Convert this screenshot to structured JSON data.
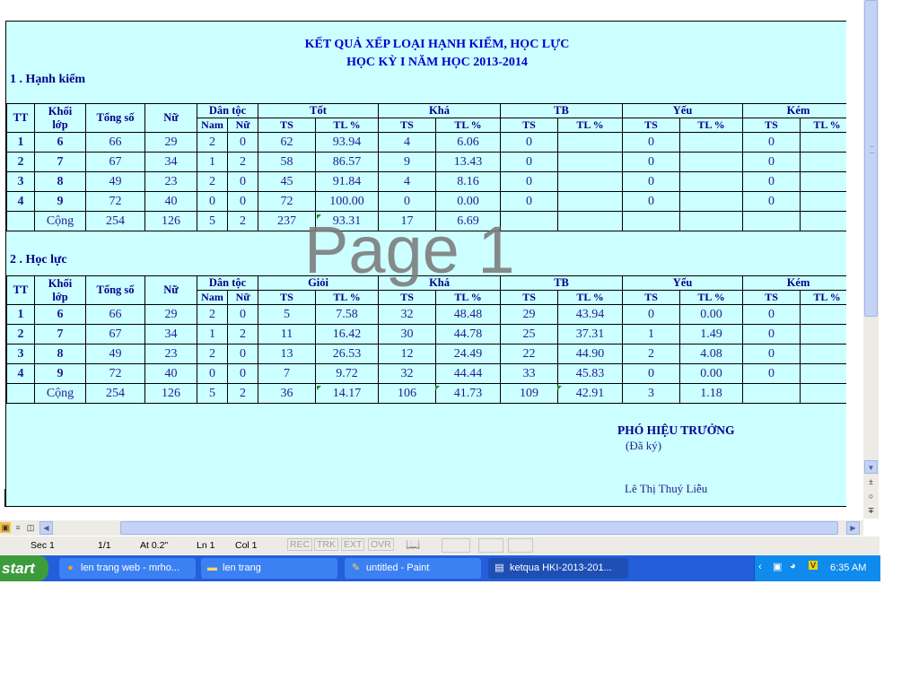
{
  "document": {
    "title_line1": "KẾT QUẢ XẾP LOẠI HẠNH KIỂM, HỌC LỰC",
    "title_line2": "HỌC KỲ I NĂM HỌC 2013-2014",
    "section1_label": "1 .  Hạnh kiểm",
    "section2_label": "2 .  Học lực",
    "watermark": "Page 1",
    "common_headers": {
      "tt": "TT",
      "khoi_line1": "Khối",
      "khoi_line2": "lớp",
      "tong_so": "Tổng số",
      "nu": "Nữ",
      "dan_toc": "Dân tộc",
      "nam": "Nam",
      "nu_sub": "Nữ",
      "ts": "TS",
      "tl": "TL %"
    },
    "conduct_table": {
      "groups": [
        "Tốt",
        "Khá",
        "TB",
        "Yếu",
        "Kém"
      ],
      "rows": [
        [
          "1",
          "6",
          "66",
          "29",
          "2",
          "0",
          "62",
          "93.94",
          "4",
          "6.06",
          "0",
          "",
          "0",
          "",
          "0",
          ""
        ],
        [
          "2",
          "7",
          "67",
          "34",
          "1",
          "2",
          "58",
          "86.57",
          "9",
          "13.43",
          "0",
          "",
          "0",
          "",
          "0",
          ""
        ],
        [
          "3",
          "8",
          "49",
          "23",
          "2",
          "0",
          "45",
          "91.84",
          "4",
          "8.16",
          "0",
          "",
          "0",
          "",
          "0",
          ""
        ],
        [
          "4",
          "9",
          "72",
          "40",
          "0",
          "0",
          "72",
          "100.00",
          "0",
          "0.00",
          "0",
          "",
          "0",
          "",
          "0",
          ""
        ],
        [
          "",
          "Cộng",
          "254",
          "126",
          "5",
          "2",
          "237",
          "93.31",
          "17",
          "6.69",
          "",
          "",
          "",
          "",
          "",
          ""
        ]
      ]
    },
    "academic_table": {
      "groups": [
        "Giỏi",
        "Khá",
        "TB",
        "Yếu",
        "Kém"
      ],
      "rows": [
        [
          "1",
          "6",
          "66",
          "29",
          "2",
          "0",
          "5",
          "7.58",
          "32",
          "48.48",
          "29",
          "43.94",
          "0",
          "0.00",
          "0",
          ""
        ],
        [
          "2",
          "7",
          "67",
          "34",
          "1",
          "2",
          "11",
          "16.42",
          "30",
          "44.78",
          "25",
          "37.31",
          "1",
          "1.49",
          "0",
          ""
        ],
        [
          "3",
          "8",
          "49",
          "23",
          "2",
          "0",
          "13",
          "26.53",
          "12",
          "24.49",
          "22",
          "44.90",
          "2",
          "4.08",
          "0",
          ""
        ],
        [
          "4",
          "9",
          "72",
          "40",
          "0",
          "0",
          "7",
          "9.72",
          "32",
          "44.44",
          "33",
          "45.83",
          "0",
          "0.00",
          "0",
          ""
        ],
        [
          "",
          "Cộng",
          "254",
          "126",
          "5",
          "2",
          "36",
          "14.17",
          "106",
          "41.73",
          "109",
          "42.91",
          "3",
          "1.18",
          "",
          ""
        ]
      ]
    },
    "signature": {
      "title": "PHÓ HIỆU TRƯỞNG",
      "note": "(Đã ký)",
      "name": "Lê Thị Thuý Liễu"
    }
  },
  "status_bar": {
    "section": "Sec 1",
    "page": "1/1",
    "at": "At 0.2\"",
    "line": "Ln 1",
    "col": "Col 1",
    "rec": "REC",
    "trk": "TRK",
    "ext": "EXT",
    "ovr": "OVR"
  },
  "taskbar": {
    "start": "start",
    "tasks": [
      {
        "label": "len trang web - mrho...",
        "icon": "firefox-icon"
      },
      {
        "label": "len trang",
        "icon": "folder-icon"
      },
      {
        "label": "untitled - Paint",
        "icon": "paint-icon"
      },
      {
        "label": "ketqua HKI-2013-201...",
        "icon": "word-icon"
      }
    ],
    "clock": "6:35 AM"
  },
  "colors": {
    "page_bg": "#ccffff",
    "text": "#1f1f8f",
    "taskbar": "#245edb",
    "start": "#3c9c3c"
  }
}
